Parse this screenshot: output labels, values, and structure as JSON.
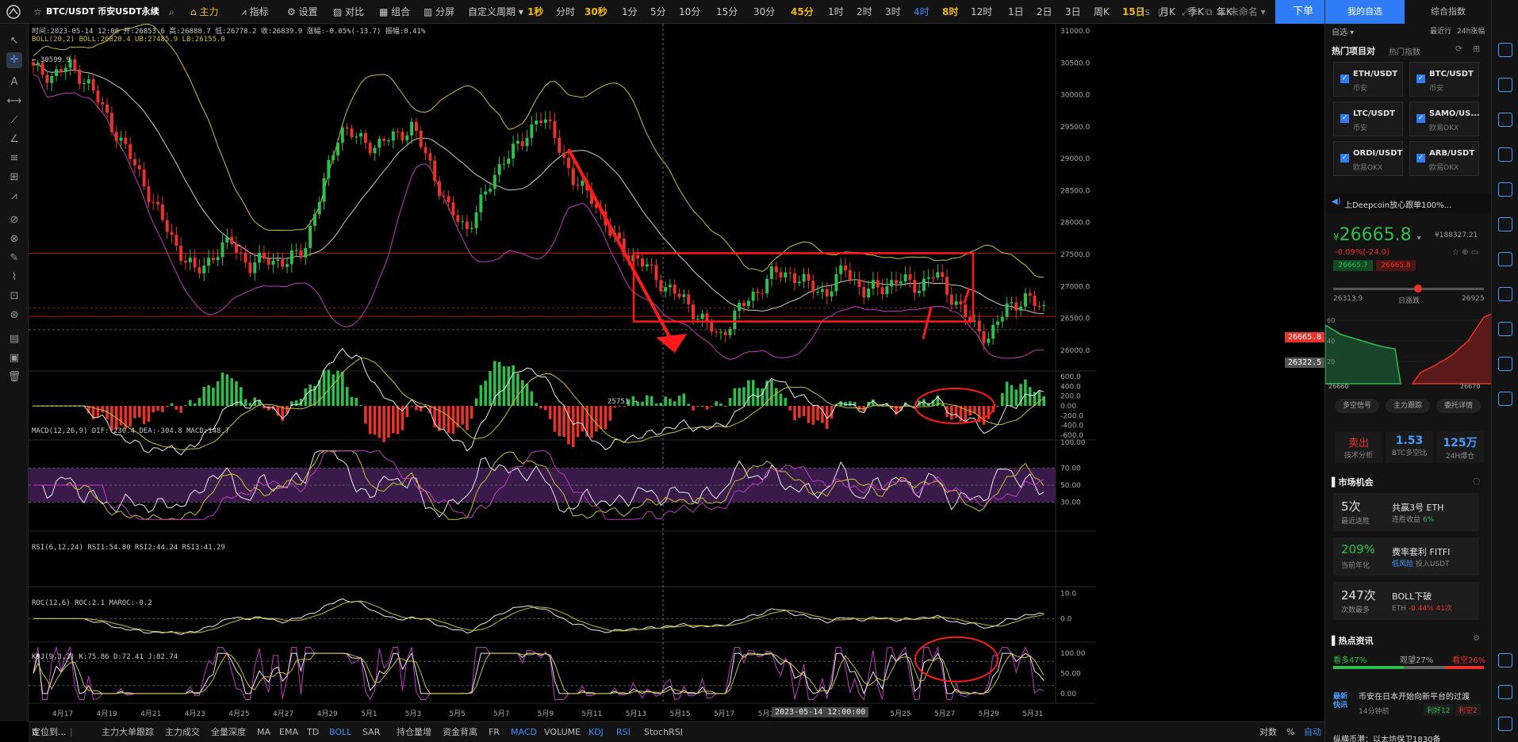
{
  "toolbar": {
    "symbol": "BTC/USDT 币安USDT永续",
    "main_label": "主力",
    "indicators_label": "指标",
    "settings_label": "设置",
    "compare_label": "对比",
    "combo_label": "组合",
    "split_label": "分屏",
    "custom_period_label": "自定义周期",
    "timeframes": [
      "1秒",
      "分时",
      "30秒",
      "1分",
      "5分",
      "10分",
      "15分",
      "30分",
      "45分",
      "1时",
      "2时",
      "3时",
      "4时",
      "8时",
      "12时",
      "1日",
      "2日",
      "3日",
      "周K",
      "15日",
      "月K",
      "季K",
      "年K"
    ],
    "timeframes_bold": [
      "1秒",
      "30秒",
      "45分",
      "8时",
      "15日"
    ],
    "active_timeframe": "4时",
    "refresh_label": "1s",
    "unnamed_label": "未命名",
    "order_button": "下单"
  },
  "chart_header": {
    "ohlc": "时间:2023-05-14 12:00  开:26853.6  高:26888.7  低:26778.2  收:26839.9  涨幅:-0.05%(-13.7)  振幅:0.41%",
    "boll": "BOLL(20,2)  BOLL:26820.4  UB:27485.9  LB:26155.0",
    "high_marker": "30599.9",
    "low_marker": "25751",
    "macd": "MACD(12,26,9)  DIF:-230.4  DEA:-304.8  MACD:148.7",
    "rsi": "RSI(6,12,24)  RSI1:54.80  RSI2:44.24  RSI3:41.29",
    "roc": "ROC(12,6)  ROC:2.1  MAROC:-0.2",
    "kdj": "KDJ(9,3,3)  K:75.86  D:72.41  J:82.74",
    "crosshair_time": "2023-05-14 12:00:00",
    "price_tag_current": "26665.8",
    "price_tag_cross": "26322.5"
  },
  "chart_data": {
    "type": "candlestick",
    "price_axis": [
      "31000.0",
      "30500.0",
      "30000.0",
      "29500.0",
      "29000.0",
      "28500.0",
      "28000.0",
      "27500.0",
      "27000.0",
      "26500.0",
      "26000.0"
    ],
    "price_ylim": [
      25700,
      31050
    ],
    "macd_axis": [
      "600.0",
      "400.0",
      "200.0",
      "0.00",
      "-200.0",
      "-400.0",
      "-600.0"
    ],
    "rsi_axis": [
      "100.00",
      "70.00",
      "50.00",
      "30.00"
    ],
    "roc_axis": [
      "10.0",
      "0.0"
    ],
    "kdj_axis": [
      "100.00",
      "50.00",
      "0.00"
    ],
    "date_axis": [
      "4月17",
      "4月19",
      "4月21",
      "4月23",
      "4月25",
      "4月27",
      "4月29",
      "5月1",
      "5月3",
      "5月5",
      "5月7",
      "5月9",
      "5月11",
      "5月13",
      "5月15",
      "5月17",
      "5月19",
      "5月21",
      "5月23",
      "5月25",
      "5月27",
      "5月29",
      "5月31"
    ],
    "close_path": [
      30400,
      30300,
      30450,
      30200,
      29700,
      29200,
      28700,
      28100,
      27600,
      27200,
      27500,
      27700,
      27300,
      27450,
      27350,
      27600,
      28500,
      29500,
      29300,
      29200,
      29350,
      29500,
      28900,
      28200,
      27900,
      28400,
      29000,
      29200,
      29700,
      29300,
      28600,
      28400,
      27800,
      27500,
      27300,
      27000,
      26800,
      26500,
      26200,
      26600,
      26900,
      27200,
      27200,
      27000,
      26900,
      27300,
      26900,
      27000,
      27100,
      27000,
      27200,
      26800,
      26400,
      26200,
      26700,
      26800,
      26660
    ],
    "horizontal_lines": [
      27520,
      26530
    ]
  },
  "bottom_bar": {
    "locate": "定位到...",
    "items": [
      "主力大单跟踪",
      "主力成交",
      "全量深度",
      "MA",
      "EMA",
      "TD",
      "BOLL",
      "SAR",
      "持仓量增",
      "资金背离",
      "FR",
      "MACD",
      "VOLUME",
      "KDJ",
      "RSI",
      "StochRSI"
    ],
    "active_items": [
      "BOLL",
      "MACD",
      "KDJ",
      "RSI"
    ],
    "log_label": "对数",
    "pct_label": "%",
    "auto_label": "自动"
  },
  "right_panel": {
    "tab_watchlist": "我的自选",
    "tab_index": "综合指数",
    "sub_label": "自选",
    "recent_label": "最近行",
    "change_24h": "24h涨幅",
    "hot_project": "热门项目对",
    "hot_index": "热门指数",
    "pairs": [
      {
        "name": "ETH/USDT",
        "exchange": "币安"
      },
      {
        "name": "BTC/USDT",
        "exchange": "币安"
      },
      {
        "name": "LTC/USDT",
        "exchange": "币安"
      },
      {
        "name": "SAMO/US...",
        "exchange": "欧易OKX"
      },
      {
        "name": "ORDI/USDT",
        "exchange": "欧易OKX"
      },
      {
        "name": "ARB/USDT",
        "exchange": "欧易OKX"
      }
    ],
    "banner": "上Deepcoin放心跟单100%...",
    "price": "26665.8",
    "price_prefix": "¥",
    "cny_price": "¥188327.21",
    "change": "-0.09%(-24.0)",
    "bid": "26665.7",
    "ask": "26665.8",
    "range_low": "26313.9",
    "range_label": "日涨跌",
    "range_high": "26925",
    "depth_left": "26660",
    "depth_right": "26670",
    "depth_axis": [
      "60",
      "40",
      "20"
    ],
    "depth_buttons": [
      "多空信号",
      "主力跟踪",
      "委托详情"
    ],
    "signal": "卖出",
    "signal_sub": "技术分析",
    "ratio": "1.53",
    "ratio_sub": "BTC多空比",
    "volume": "125万",
    "volume_sub": "24H爆仓",
    "market_title": "市场机会",
    "opps": [
      {
        "big": "5次",
        "sub": "最近连胜",
        "t1": "共赢3号 ETH",
        "t2": "连胜收益",
        "t2v": "6%"
      },
      {
        "big": "209%",
        "sub": "当前年化",
        "t1": "费率套利 FITFI",
        "t2": "低风险",
        "t2v": "投入USDT"
      },
      {
        "big": "247次",
        "sub": "次数最多",
        "t1": "BOLL下破",
        "t2": "ETH",
        "t2v": "-0.44% 41次"
      }
    ],
    "news_title": "热点资讯",
    "bull_pct": "看多47%",
    "neutral_pct": "观望27%",
    "bear_pct": "看空26%",
    "news_tag": "最新快讯",
    "news_text": "币安在日本开始向新平台的过渡",
    "news_time": "14分钟前",
    "news_good": "利好12",
    "news_bad": "利空2",
    "news_text2": "纵横币港：以太坊保卫1830备"
  },
  "colors": {
    "up": "#2fbd4e",
    "down": "#e8322b",
    "accent": "#2f7cf6",
    "annotation": "#ff1a1a",
    "boll_upper": "#c9c02c",
    "boll_lower": "#c03ac0"
  }
}
